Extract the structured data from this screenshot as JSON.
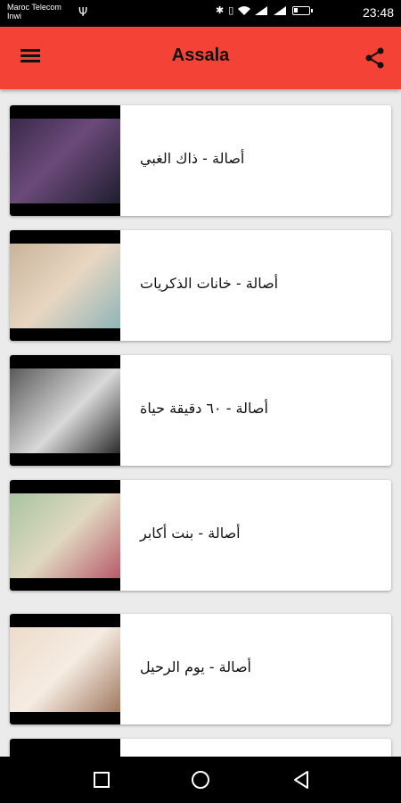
{
  "status_bar": {
    "carrier_line1": "Maroc Telecom",
    "carrier_line2": "Inwi",
    "battery_level": "4",
    "time": "23:48"
  },
  "app_bar": {
    "title": "Assala"
  },
  "songs": [
    {
      "title": "أصالة - ذاك الغبي",
      "icon": "album-thumbnail"
    },
    {
      "title": "أصالة - خانات الذكريات",
      "icon": "album-thumbnail"
    },
    {
      "title": "أصالة - ٦٠ دقيقة حياة",
      "icon": "album-thumbnail"
    },
    {
      "title": "أصالة - بنت أكابر",
      "icon": "album-thumbnail"
    },
    {
      "title": "أصالة - يوم الرحيل",
      "icon": "album-thumbnail"
    }
  ],
  "colors": {
    "accent": "#f44336",
    "background": "#ebebeb"
  }
}
